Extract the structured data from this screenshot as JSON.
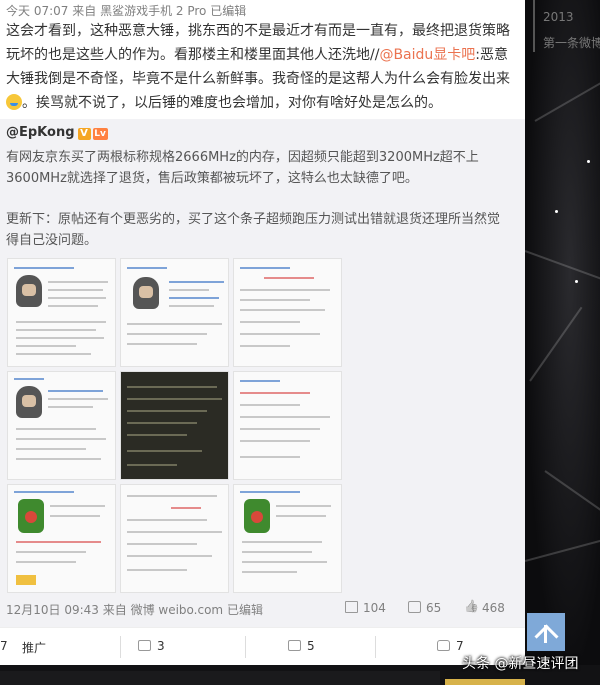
{
  "post": {
    "meta": {
      "time": "今天 07:07",
      "source_prefix": "来自",
      "device": "黑鲨游戏手机 2 Pro",
      "edited": "已编辑"
    },
    "text_part1": "这会才看到，这种恶意大锤，挑东西的不是最近才有而是一直有，最终把退货策略玩坏的也是这些人的作为。看那楼主和楼里面其他人还洗地//",
    "mention": "@Baidu显卡吧",
    "text_part2": ":恶意大锤我倒是不奇怪，毕竟不是什么新鲜事。我奇怪的是这帮人为什么会有脸发出来",
    "text_part3": "。挨骂就不说了，以后锤的难度也会增加，对你有啥好处是怎么的。",
    "emoji": "doge-face-icon"
  },
  "repost": {
    "author": "@EpKong",
    "verified": "V",
    "level": "Lv",
    "text1": "有网友京东买了两根标称规格2666MHz的内存，因超频只能超到3200MHz超不上3600MHz就选择了退货，售后政策都被玩坏了，这特么也太缺德了吧。",
    "text2": "更新下：原帖还有个更恶劣的，买了这个条子超频跑压力测试出错就退货还理所当然觉得自己没问题。",
    "footer": {
      "date": "12月10日 09:43",
      "source": "来自 微博 weibo.com",
      "edited": "已编辑",
      "shares": "104",
      "comments": "65",
      "likes": "468"
    }
  },
  "actions": {
    "left_count": "7",
    "promote": "推广",
    "share_count": "3",
    "comment_count": "5",
    "like_count": "7"
  },
  "sidebar": {
    "year": "2013",
    "first_weibo": "第一条微博"
  },
  "watermark": {
    "prefix": "头条",
    "handle": "@新昼速评团"
  }
}
